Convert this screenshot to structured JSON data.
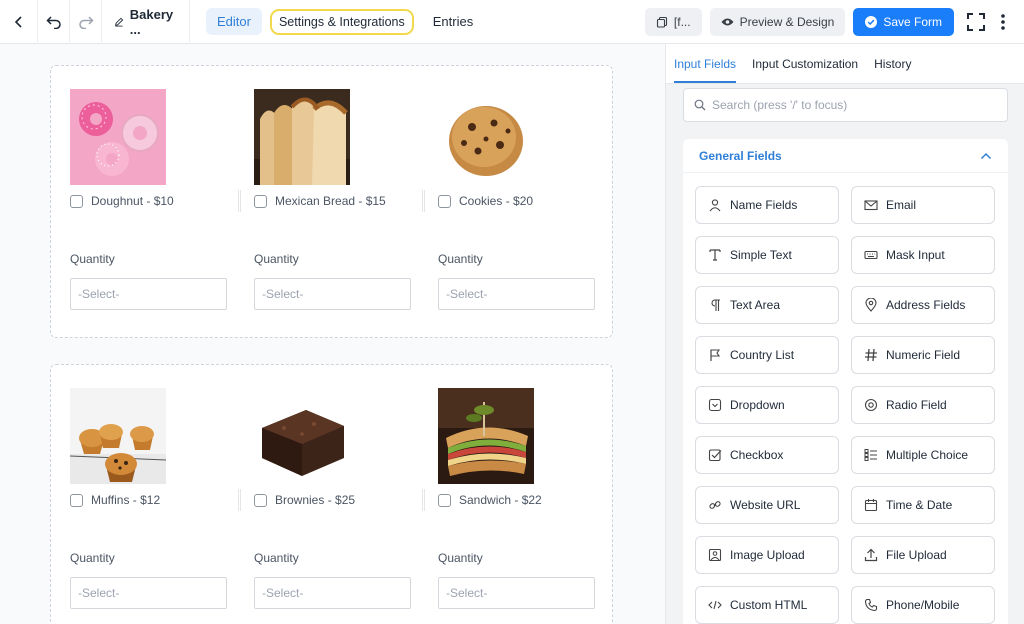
{
  "toolbar": {
    "form_title": "Bakery ...",
    "tabs": [
      "Editor",
      "Settings & Integrations",
      "Entries"
    ],
    "shortcode_label": "[f...",
    "preview_label": "Preview & Design",
    "save_label": "Save Form"
  },
  "products": [
    {
      "label": "Doughnut - $10",
      "quantity_label": "Quantity",
      "select_value": "-Select-",
      "image": "donut-photo"
    },
    {
      "label": "Mexican Bread - $15",
      "quantity_label": "Quantity",
      "select_value": "-Select-",
      "image": "bread-photo"
    },
    {
      "label": "Cookies - $20",
      "quantity_label": "Quantity",
      "select_value": "-Select-",
      "image": "cookie-photo"
    },
    {
      "label": "Muffins - $12",
      "quantity_label": "Quantity",
      "select_value": "-Select-",
      "image": "muffin-photo"
    },
    {
      "label": "Brownies - $25",
      "quantity_label": "Quantity",
      "select_value": "-Select-",
      "image": "brownie-photo"
    },
    {
      "label": "Sandwich - $22",
      "quantity_label": "Quantity",
      "select_value": "-Select-",
      "image": "sandwich-photo"
    }
  ],
  "panel": {
    "tabs": [
      "Input Fields",
      "Input Customization",
      "History"
    ],
    "search_placeholder": "Search (press '/' to focus)",
    "group_title": "General Fields",
    "fields": [
      {
        "label": "Name Fields",
        "icon": "person-icon"
      },
      {
        "label": "Email",
        "icon": "envelope-icon"
      },
      {
        "label": "Simple Text",
        "icon": "text-cursor-icon"
      },
      {
        "label": "Mask Input",
        "icon": "keyboard-icon"
      },
      {
        "label": "Text Area",
        "icon": "paragraph-icon"
      },
      {
        "label": "Address Fields",
        "icon": "location-pin-icon"
      },
      {
        "label": "Country List",
        "icon": "flag-icon"
      },
      {
        "label": "Numeric Field",
        "icon": "hash-icon"
      },
      {
        "label": "Dropdown",
        "icon": "dropdown-icon"
      },
      {
        "label": "Radio Field",
        "icon": "radio-icon"
      },
      {
        "label": "Checkbox",
        "icon": "checkbox-icon"
      },
      {
        "label": "Multiple Choice",
        "icon": "list-icon"
      },
      {
        "label": "Website URL",
        "icon": "link-icon"
      },
      {
        "label": "Time & Date",
        "icon": "calendar-icon"
      },
      {
        "label": "Image Upload",
        "icon": "image-icon"
      },
      {
        "label": "File Upload",
        "icon": "upload-icon"
      },
      {
        "label": "Custom HTML",
        "icon": "code-icon"
      },
      {
        "label": "Phone/Mobile",
        "icon": "phone-icon"
      }
    ]
  },
  "colors": {
    "accent": "#1a7efb",
    "tab_text": "#2f7fd6",
    "highlight_border": "#f2d94b"
  }
}
